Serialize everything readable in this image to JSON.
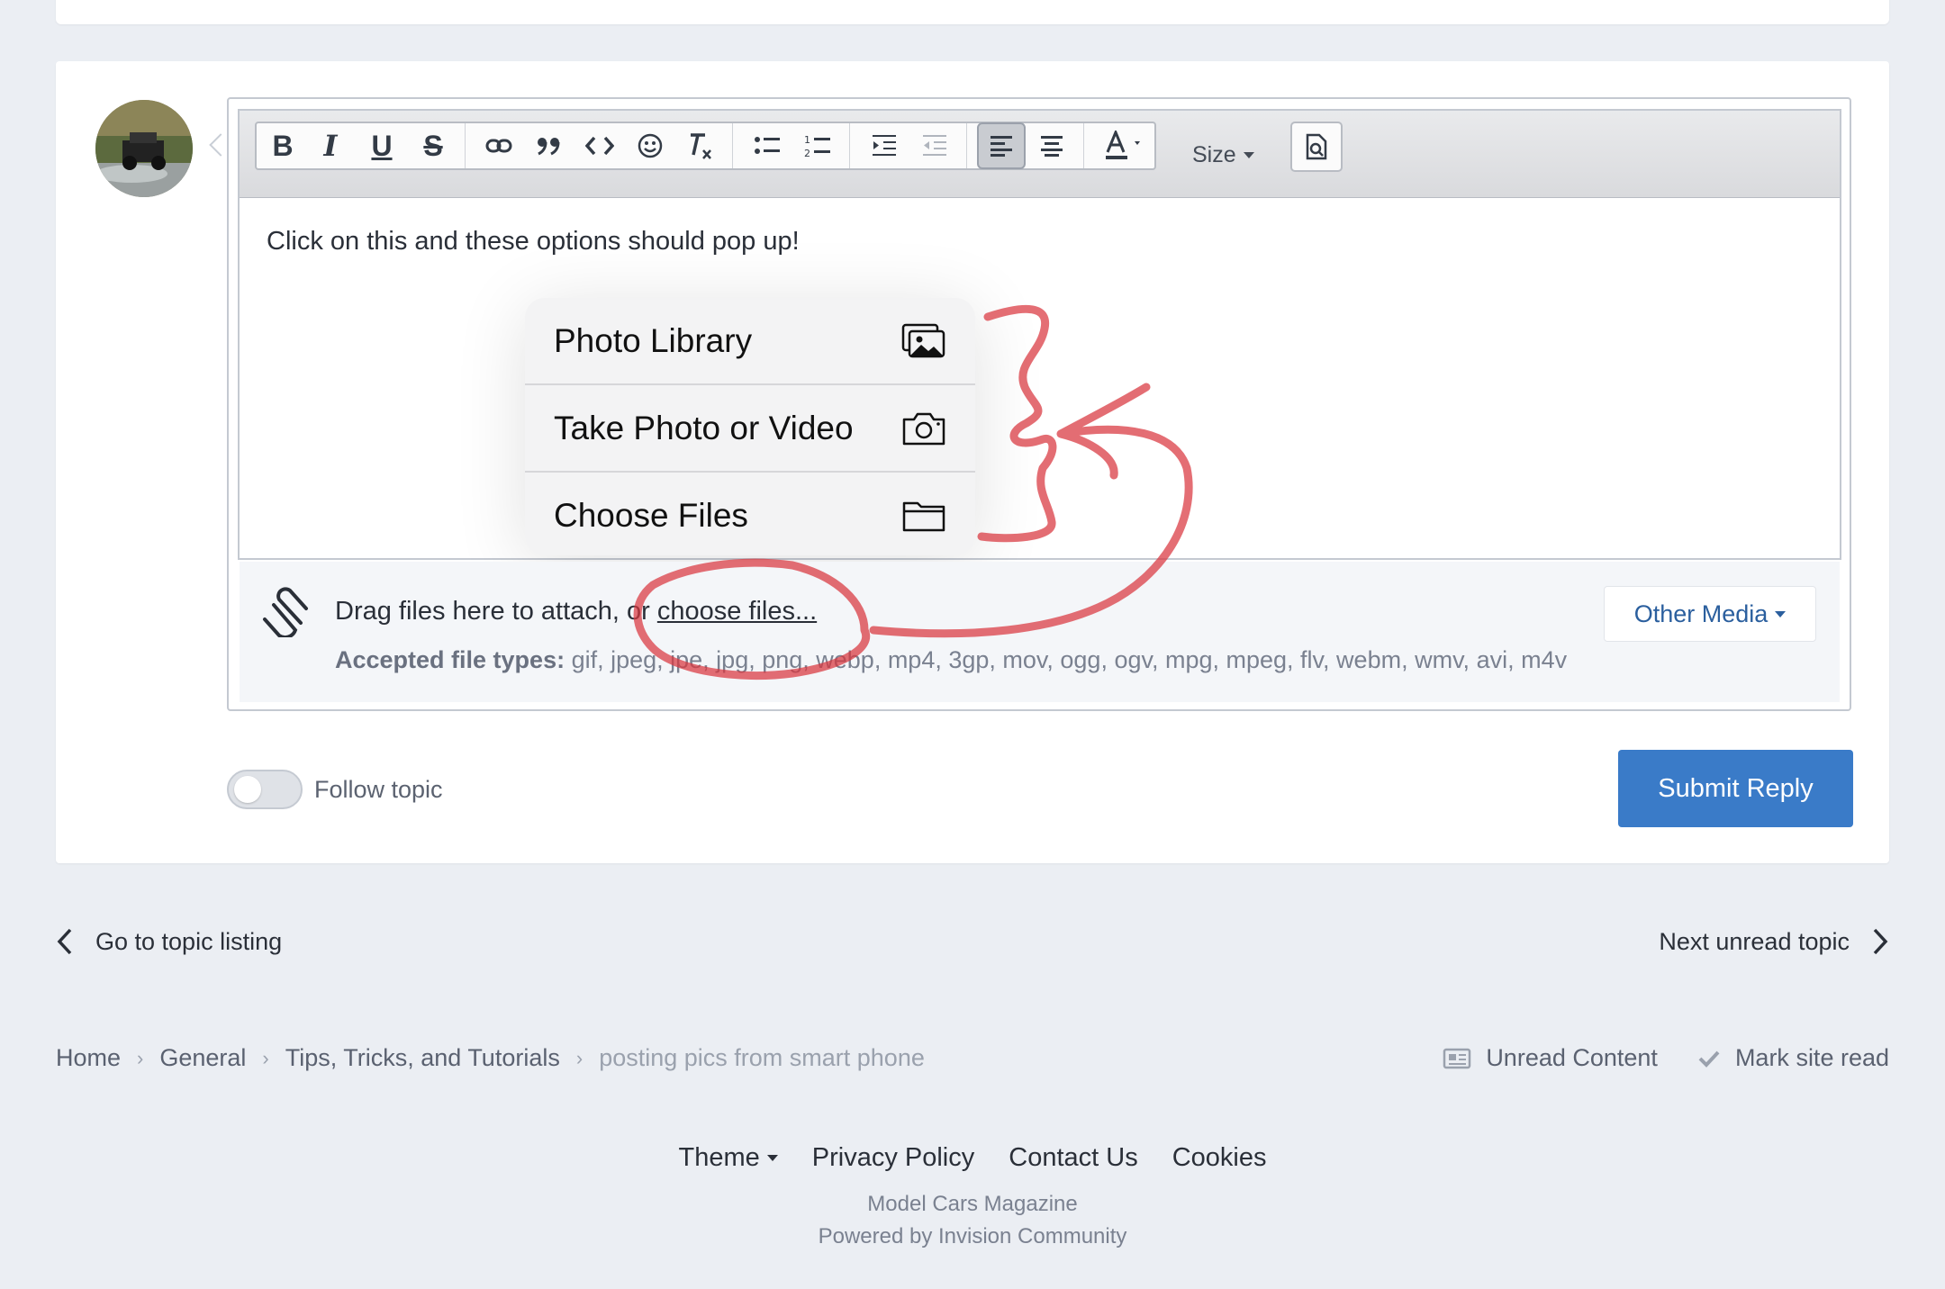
{
  "toolbar": {
    "bold": "B",
    "italic": "I",
    "underline": "U",
    "strike": "S",
    "size_label": "Size",
    "buttons": [
      "bold",
      "italic",
      "underline",
      "strikethrough",
      "link",
      "quote",
      "code",
      "emoji",
      "remove-format",
      "bulleted-list",
      "numbered-list",
      "indent",
      "outdent",
      "align-left",
      "align-center",
      "text-color",
      "preview"
    ],
    "active_button": "align-left"
  },
  "editor": {
    "content": "Click on this and these options should pop up!"
  },
  "popup_menu": {
    "items": [
      {
        "label": "Photo Library",
        "icon": "photo-library-icon"
      },
      {
        "label": "Take Photo or Video",
        "icon": "camera-icon"
      },
      {
        "label": "Choose Files",
        "icon": "folder-icon"
      }
    ]
  },
  "attachments": {
    "drag_text": "Drag files here to attach, or ",
    "choose_link": "choose files...",
    "accepted_label": "Accepted file types:",
    "accepted_types": " gif, jpeg, jpe, jpg, png, webp, mp4, 3gp, mov, ogg, ogv, mpg, mpeg, flv, webm, wmv, avi, m4v",
    "other_media": "Other Media"
  },
  "follow": {
    "label": "Follow topic",
    "enabled": false
  },
  "submit_label": "Submit Reply",
  "nav": {
    "prev": "Go to topic listing",
    "next": "Next unread topic"
  },
  "breadcrumb": {
    "items": [
      "Home",
      "General",
      "Tips, Tricks, and Tutorials",
      "posting pics from smart phone"
    ]
  },
  "quick_links": {
    "unread": "Unread Content",
    "mark_read": "Mark site read"
  },
  "footer": {
    "theme": "Theme",
    "privacy": "Privacy Policy",
    "contact": "Contact Us",
    "cookies": "Cookies",
    "site_name": "Model Cars Magazine",
    "powered": "Powered by Invision Community"
  },
  "colors": {
    "page_bg": "#ebeef3",
    "accent": "#3a7bc8",
    "annotation": "#d9363e"
  }
}
